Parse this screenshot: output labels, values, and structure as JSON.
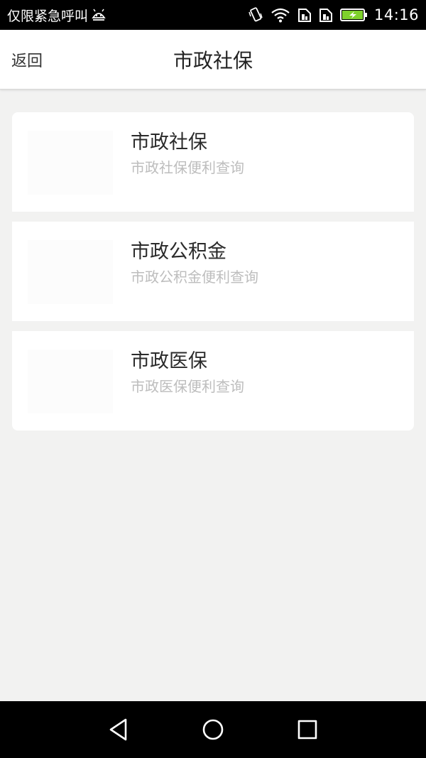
{
  "status_bar": {
    "carrier_text": "仅限紧急呼叫",
    "time": "14:16",
    "icons": [
      "android-debug-icon",
      "vibrate-icon",
      "wifi-icon",
      "sim1-icon",
      "sim2-icon",
      "battery-charging-icon"
    ]
  },
  "header": {
    "back_label": "返回",
    "title": "市政社保"
  },
  "cards": [
    {
      "title": "市政社保",
      "subtitle": "市政社保便利查询"
    },
    {
      "title": "市政公积金",
      "subtitle": "市政公积金便利查询"
    },
    {
      "title": "市政医保",
      "subtitle": "市政医保便利查询"
    }
  ],
  "nav_bar": {
    "icons": [
      "back-triangle-icon",
      "home-circle-icon",
      "recents-square-icon"
    ]
  },
  "colors": {
    "background": "#f2f2f1",
    "card": "#ffffff",
    "subtitle": "#bdbdbd",
    "battery": "#7fd12c"
  }
}
